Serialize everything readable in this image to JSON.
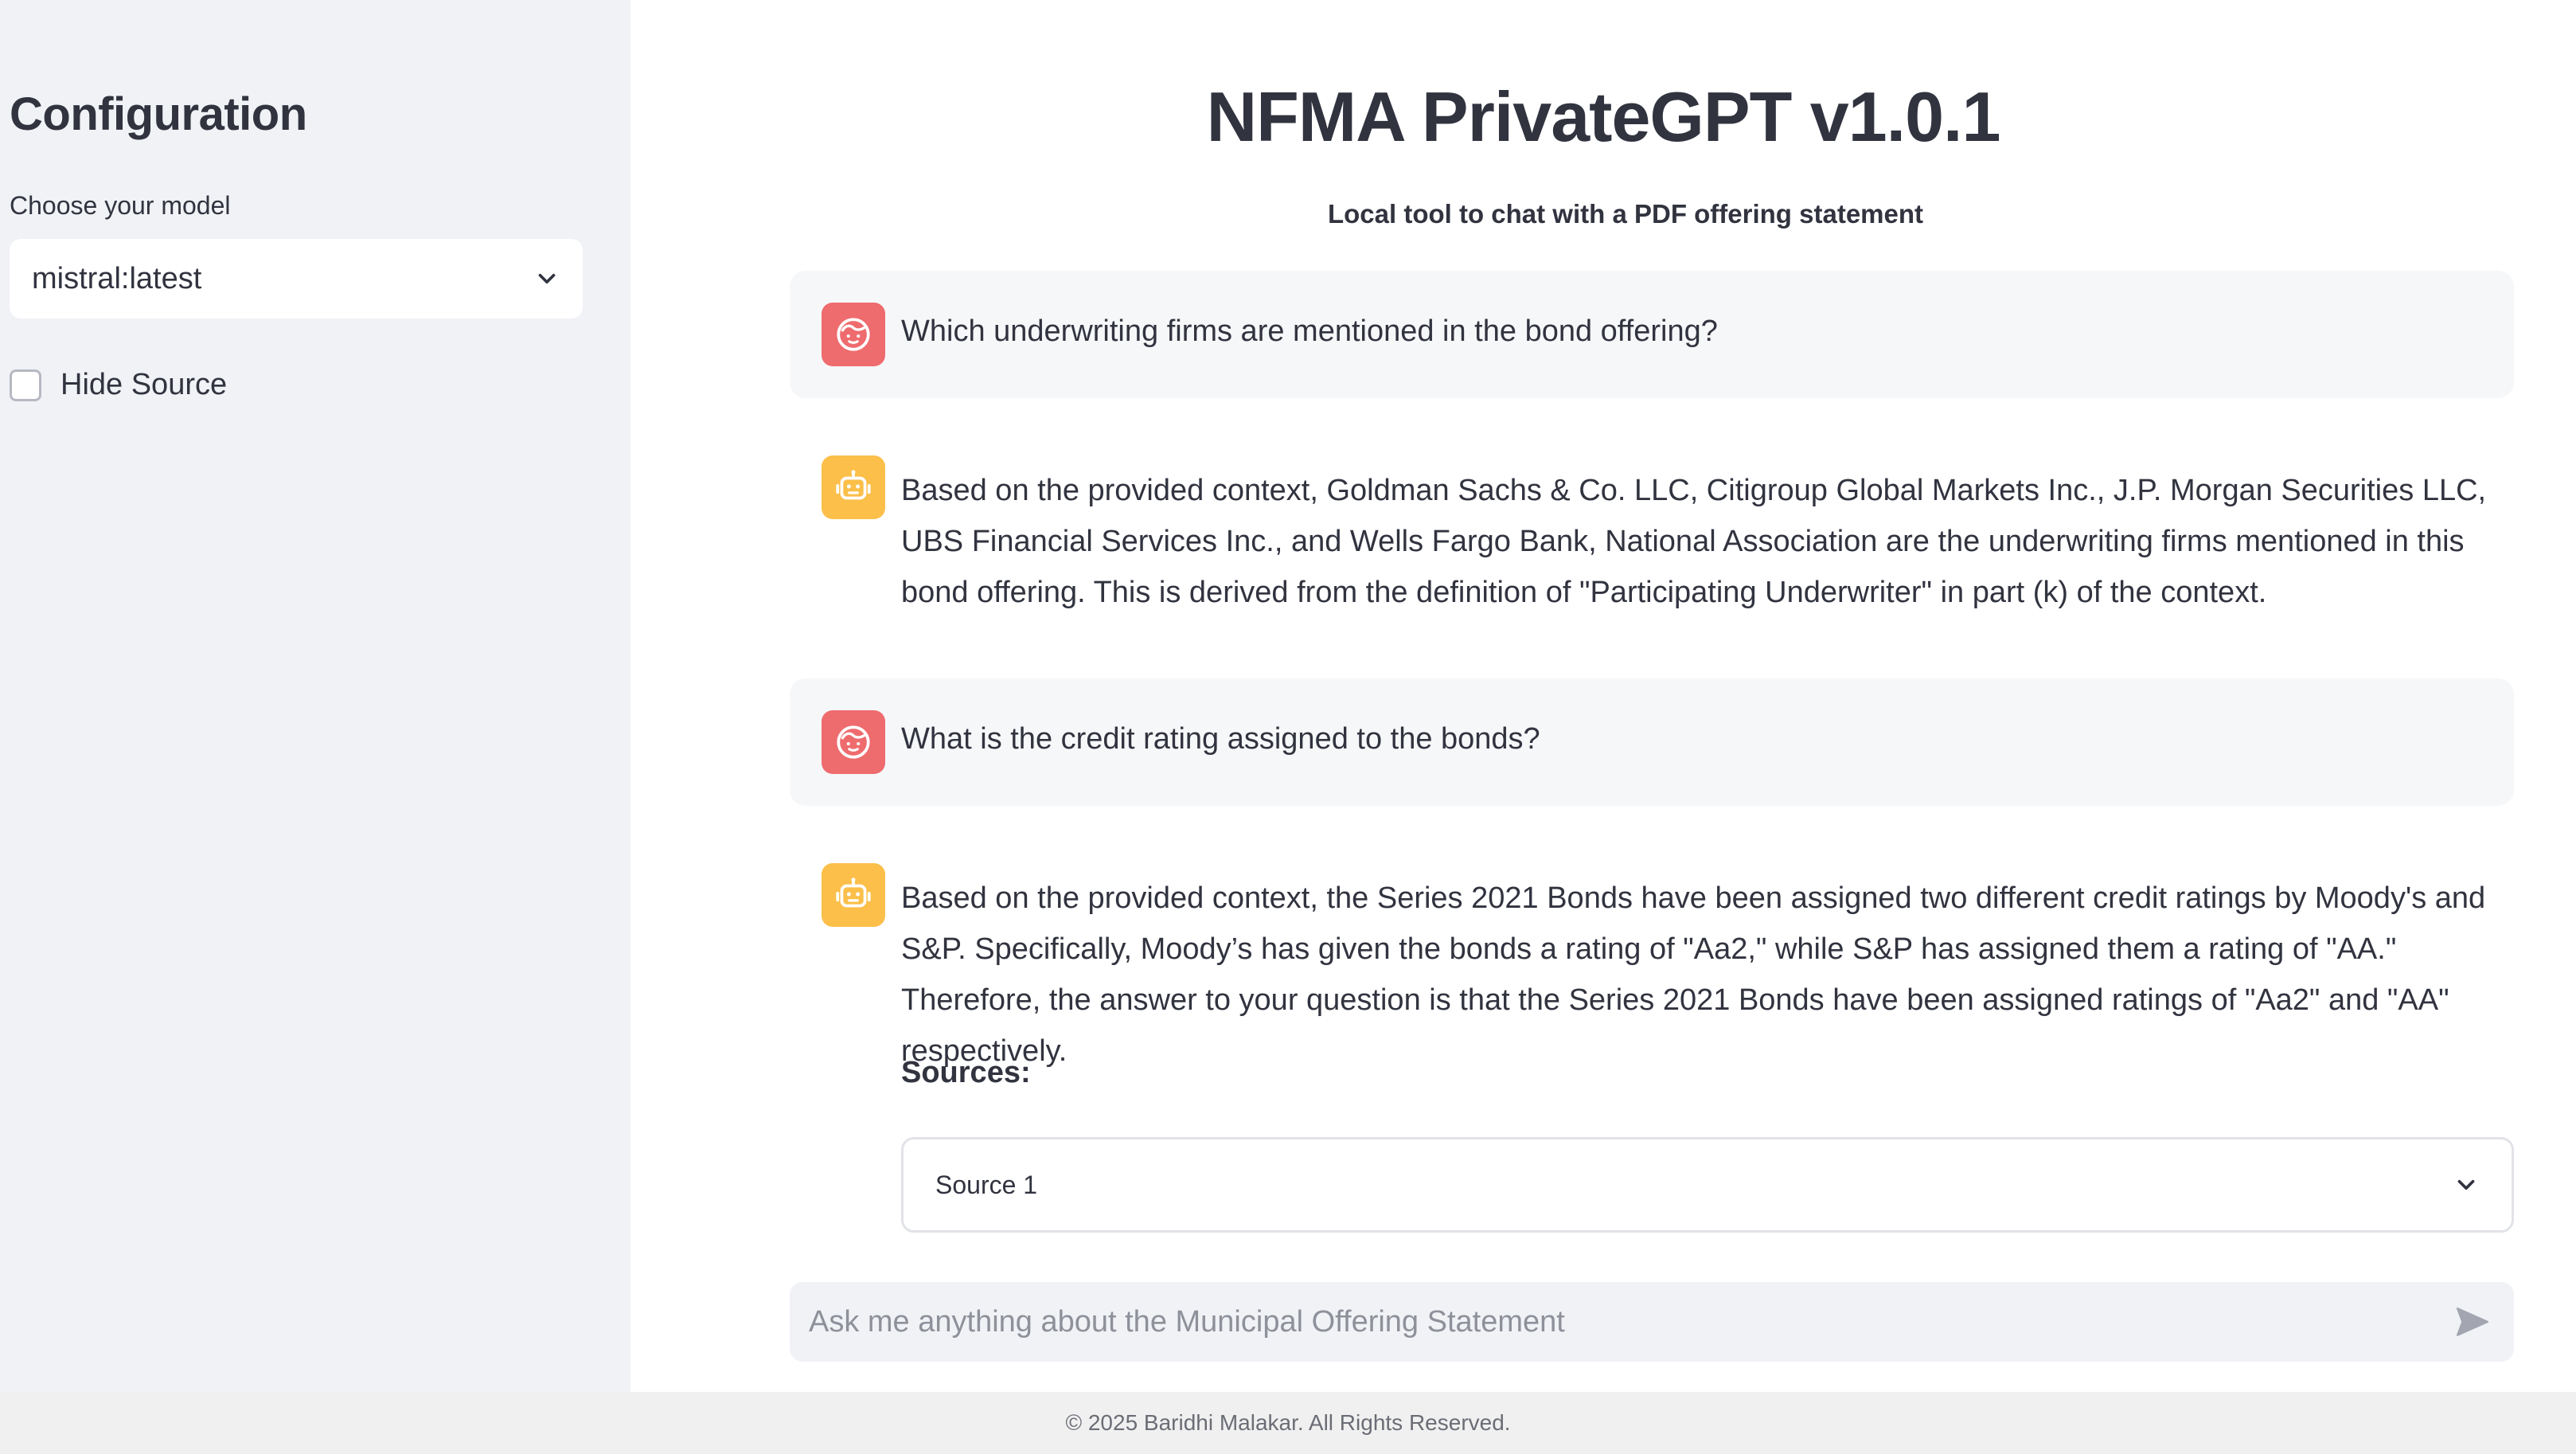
{
  "sidebar": {
    "title": "Configuration",
    "model_label": "Choose your model",
    "model_selected": "mistral:latest",
    "hide_source_label": "Hide Source"
  },
  "main": {
    "title": "NFMA PrivateGPT v1.0.1",
    "subtitle": "Local tool to chat with a PDF offering statement",
    "messages": [
      {
        "role": "user",
        "text": "Which underwriting firms are mentioned in the bond offering?"
      },
      {
        "role": "assistant",
        "text": "Based on the provided context, Goldman Sachs & Co. LLC, Citigroup Global Markets Inc., J.P. Morgan Securities LLC, UBS Financial Services Inc., and Wells Fargo Bank, National Association are the underwriting firms mentioned in this bond offering. This is derived from the definition of \"Participating Underwriter\" in part (k) of the context."
      },
      {
        "role": "user",
        "text": "What is the credit rating assigned to the bonds?"
      },
      {
        "role": "assistant",
        "text": "Based on the provided context, the Series 2021 Bonds have been assigned two different credit ratings by Moody's and S&P. Specifically, Moody’s has given the bonds a rating of \"Aa2,\" while S&P has assigned them a rating of \"AA.\" Therefore, the answer to your question is that the Series 2021 Bonds have been assigned ratings of \"Aa2\" and \"AA\" respectively.",
        "sources_label": "Sources:",
        "sources": [
          "Source 1"
        ]
      }
    ],
    "chat_input_placeholder": "Ask me anything about the Municipal Offering Statement"
  },
  "footer": {
    "text": "© 2025 Baridhi Malakar. All Rights Reserved."
  },
  "icons": {
    "user_avatar": "user-face-icon",
    "bot_avatar": "robot-face-icon",
    "select_chevron": "chevron-down-icon",
    "send": "send-icon"
  },
  "colors": {
    "sidebar_bg": "#f0f2f6",
    "user_avatar": "#ee6b6e",
    "bot_avatar": "#fbbf4a",
    "user_message_bg": "#f6f7f9",
    "text": "#31333f"
  }
}
